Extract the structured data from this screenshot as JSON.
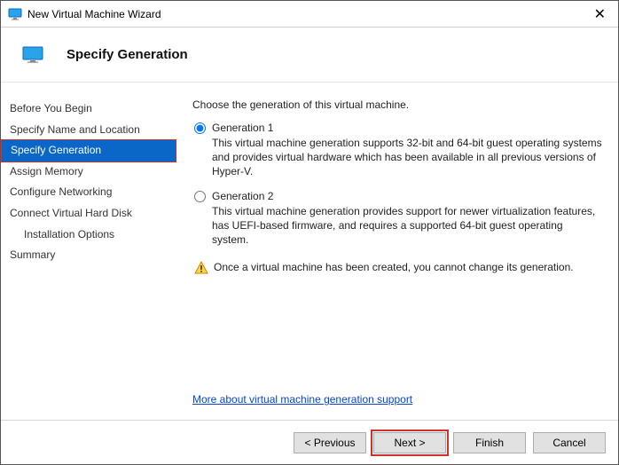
{
  "window": {
    "title": "New Virtual Machine Wizard"
  },
  "header": {
    "title": "Specify Generation"
  },
  "sidebar": {
    "items": [
      {
        "label": "Before You Begin"
      },
      {
        "label": "Specify Name and Location"
      },
      {
        "label": "Specify Generation"
      },
      {
        "label": "Assign Memory"
      },
      {
        "label": "Configure Networking"
      },
      {
        "label": "Connect Virtual Hard Disk"
      },
      {
        "label": "Installation Options"
      },
      {
        "label": "Summary"
      }
    ]
  },
  "content": {
    "intro": "Choose the generation of this virtual machine.",
    "gen1_label": "Generation 1",
    "gen1_desc": "This virtual machine generation supports 32-bit and 64-bit guest operating systems and provides virtual hardware which has been available in all previous versions of Hyper-V.",
    "gen2_label": "Generation 2",
    "gen2_desc": "This virtual machine generation provides support for newer virtualization features, has UEFI-based firmware, and requires a supported 64-bit guest operating system.",
    "warning": "Once a virtual machine has been created, you cannot change its generation.",
    "link": "More about virtual machine generation support"
  },
  "footer": {
    "previous": "< Previous",
    "next": "Next >",
    "finish": "Finish",
    "cancel": "Cancel"
  }
}
